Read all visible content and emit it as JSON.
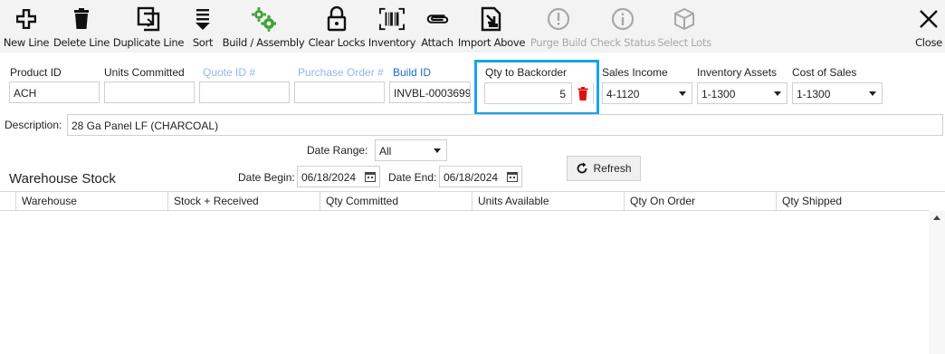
{
  "toolbar": {
    "new_line": "New Line",
    "delete_line": "Delete Line",
    "duplicate_line": "Duplicate Line",
    "sort": "Sort",
    "build_assembly": "Build / Assembly",
    "clear_locks": "Clear Locks",
    "inventory": "Inventory",
    "attach": "Attach",
    "import_above": "Import Above",
    "purge_build": "Purge Build",
    "check_status": "Check Status",
    "select_lots": "Select Lots",
    "close": "Close"
  },
  "form": {
    "product_id_label": "Product ID",
    "product_id_value": "ACH",
    "units_committed_label": "Units Committed",
    "units_committed_value": "",
    "quote_id_label": "Quote ID #",
    "quote_id_value": "",
    "purchase_order_label": "Purchase Order #",
    "purchase_order_value": "",
    "build_id_label": "Build ID",
    "build_id_value": "INVBL-0003699",
    "qty_backorder_label": "Qty to Backorder",
    "qty_backorder_value": "5",
    "sales_income_label": "Sales Income",
    "sales_income_value": "4-1120",
    "inventory_assets_label": "Inventory Assets",
    "inventory_assets_value": "1-1300",
    "cost_of_sales_label": "Cost of Sales",
    "cost_of_sales_value": "1-1300",
    "description_label": "Description:",
    "description_value": "28 Ga Panel LF (CHARCOAL)"
  },
  "filters": {
    "date_range_label": "Date Range:",
    "date_range_value": "All",
    "date_begin_label": "Date Begin:",
    "date_begin_value": "06/18/2024",
    "date_end_label": "Date End:",
    "date_end_value": "06/18/2024",
    "refresh_label": "Refresh"
  },
  "warehouse": {
    "title": "Warehouse Stock",
    "columns": [
      "Warehouse",
      "Stock + Received",
      "Qty Committed",
      "Units Available",
      "Qty On Order",
      "Qty Shipped"
    ]
  },
  "colors": {
    "highlight": "#1aa3e8",
    "trash": "#e01010",
    "gear": "#3fa535",
    "faded_label": "#8fb8e6",
    "build_id_label": "#1a6fc9"
  }
}
